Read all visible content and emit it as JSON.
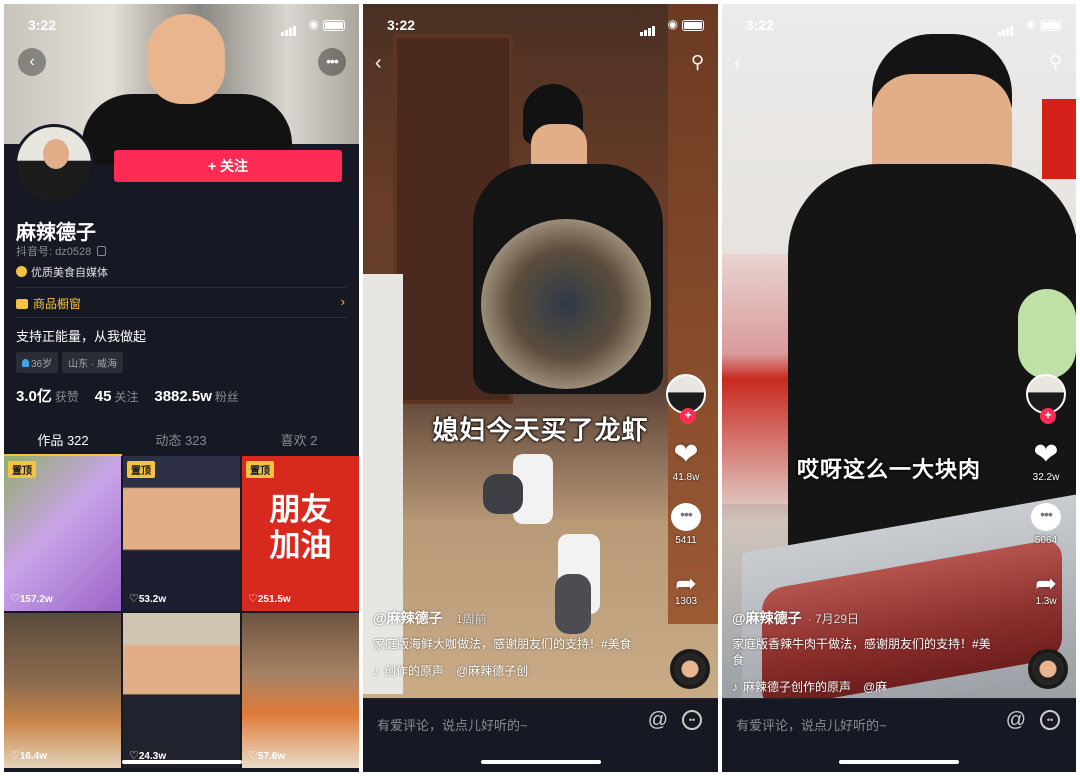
{
  "status": {
    "time": "3:22"
  },
  "profile": {
    "follow_label": "+ 关注",
    "name": "麻辣德子",
    "douyin_id": "抖音号: dz0528",
    "badge": "优质美食自媒体",
    "shop": "商品橱窗",
    "bio": "支持正能量，从我做起",
    "chips": [
      "36岁",
      "山东 · 威海"
    ],
    "stats": [
      {
        "value": "3.0亿",
        "label": "获赞"
      },
      {
        "value": "45",
        "label": "关注"
      },
      {
        "value": "3882.5w",
        "label": "粉丝"
      }
    ],
    "tabs": [
      "作品 322",
      "动态 323",
      "喜欢 2"
    ],
    "grid": [
      {
        "tag": "置顶",
        "likes": "157.2w",
        "color": "#b98bd6"
      },
      {
        "tag": "置顶",
        "likes": "53.2w",
        "color": "#3a3d55"
      },
      {
        "tag": "置顶",
        "likes": "251.5w",
        "color": "#d8291f",
        "text": "朋友\n加油"
      },
      {
        "tag": "",
        "likes": "16.4w",
        "color": "#7a5a40"
      },
      {
        "tag": "",
        "likes": "24.3w",
        "color": "#c7bfae"
      },
      {
        "tag": "",
        "likes": "57.6w",
        "color": "#8b6a4c"
      }
    ]
  },
  "video1": {
    "caption": "媳妇今天买了龙虾",
    "likes": "41.8w",
    "comments": "5411",
    "shares": "1303",
    "author": "@麻辣德子",
    "date": "· 1周前",
    "desc": "家庭版海鲜大咖做法，感谢朋友们的支持！#美食",
    "music": "创作的原声　@麻辣德子创",
    "comment_placeholder": "有爱评论，说点儿好听的~"
  },
  "video2": {
    "caption": "哎呀这么一大块肉",
    "likes": "32.2w",
    "comments": "5064",
    "shares": "1.3w",
    "author": "@麻辣德子",
    "date": "· 7月29日",
    "desc": "家庭版香辣牛肉干做法，感谢朋友们的支持！#美食",
    "music": "麻辣德子创作的原声　@麻",
    "comment_placeholder": "有爱评论，说点儿好听的~"
  },
  "colors": {
    "accent": "#fe2c55",
    "gold": "#f5c342",
    "bg": "#161823"
  }
}
